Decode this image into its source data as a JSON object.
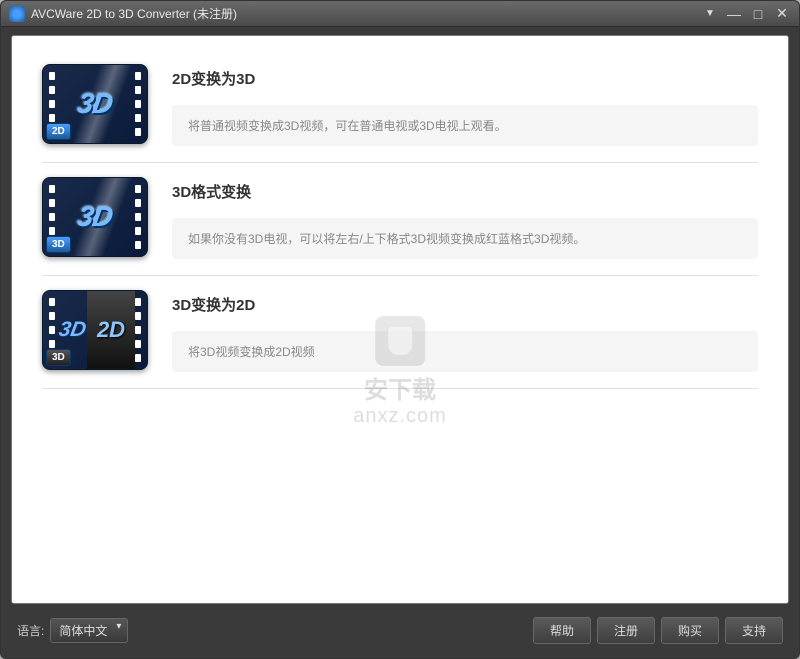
{
  "titlebar": {
    "title": "AVCWare 2D to 3D Converter (未注册)"
  },
  "options": [
    {
      "title": "2D变换为3D",
      "desc": "将普通视频变换成3D视频，可在普通电视或3D电视上观看。",
      "badge": "2D"
    },
    {
      "title": "3D格式变换",
      "desc": "如果你没有3D电视，可以将左右/上下格式3D视频变换成红蓝格式3D视频。",
      "badge": "3D"
    },
    {
      "title": "3D变换为2D",
      "desc": "将3D视频变换成2D视频",
      "badge": "3D"
    }
  ],
  "footer": {
    "lang_label": "语言:",
    "lang_value": "简体中文",
    "help": "帮助",
    "register": "注册",
    "buy": "购买",
    "support": "支持"
  },
  "watermark": {
    "cn": "安下载",
    "url": "anxz.com"
  }
}
